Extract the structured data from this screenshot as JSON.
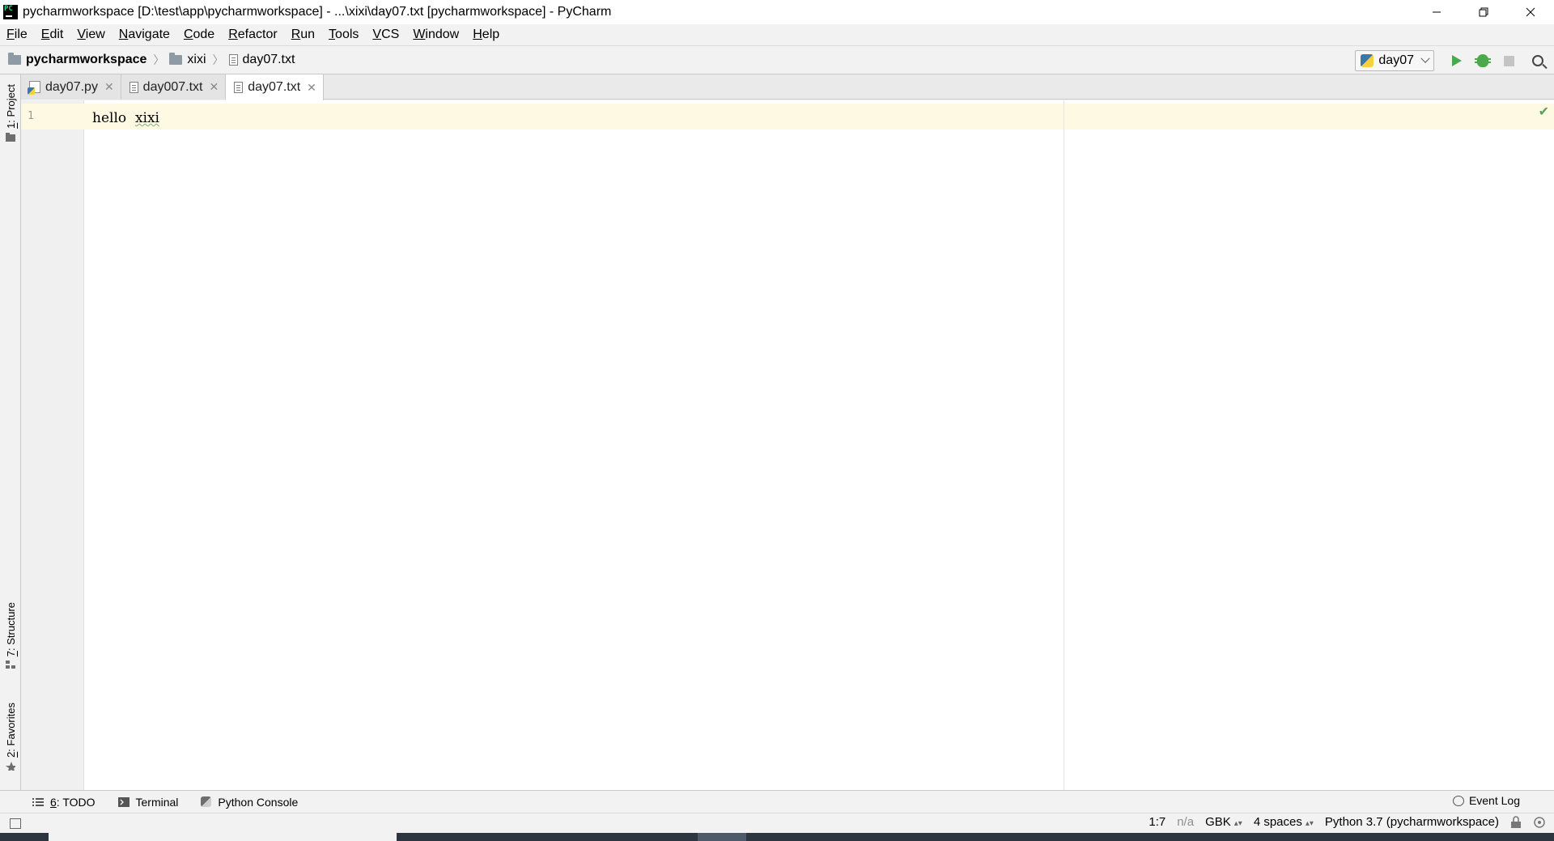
{
  "window": {
    "title": "pycharmworkspace [D:\\test\\app\\pycharmworkspace] - ...\\xixi\\day07.txt [pycharmworkspace] - PyCharm"
  },
  "menu": [
    {
      "mnemonic": "F",
      "rest": "ile"
    },
    {
      "mnemonic": "E",
      "rest": "dit"
    },
    {
      "mnemonic": "V",
      "rest": "iew"
    },
    {
      "mnemonic": "N",
      "rest": "avigate"
    },
    {
      "mnemonic": "C",
      "rest": "ode"
    },
    {
      "mnemonic": "R",
      "rest": "efactor"
    },
    {
      "mnemonic": "R",
      "rest": "un"
    },
    {
      "mnemonic": "T",
      "rest": "ools"
    },
    {
      "mnemonic": "V",
      "rest": "CS"
    },
    {
      "mnemonic": "W",
      "rest": "indow"
    },
    {
      "mnemonic": "H",
      "rest": "elp"
    }
  ],
  "breadcrumb": {
    "project": "pycharmworkspace",
    "folder": "xixi",
    "file": "day07.txt"
  },
  "toolbar": {
    "run_config": "day07"
  },
  "left_tools": {
    "project": {
      "mnemonic": "1",
      "rest": ": Project"
    },
    "structure": {
      "mnemonic": "7",
      "rest": ": Structure"
    },
    "favorites": {
      "mnemonic": "2",
      "rest": ": Favorites"
    }
  },
  "tabs": [
    {
      "label": "day07.py",
      "type": "py",
      "active": false
    },
    {
      "label": "day007.txt",
      "type": "txt",
      "active": false
    },
    {
      "label": "day07.txt",
      "type": "txt",
      "active": true
    }
  ],
  "editor": {
    "line_number": "1",
    "code_word1": "hello",
    "code_word2": "xixi"
  },
  "bottom_tools": {
    "todo": {
      "mnemonic": "6",
      "rest": ": TODO"
    },
    "terminal": "Terminal",
    "python_console": "Python Console",
    "event_log": "Event Log"
  },
  "status": {
    "position": "1:7",
    "na": "n/a",
    "encoding": "GBK",
    "indent": "4 spaces",
    "interpreter": "Python 3.7 (pycharmworkspace)"
  },
  "colors": {
    "caret_row": "#fdf9e3",
    "run_green": "#4aa94a",
    "chrome_bg": "#f2f2f2"
  }
}
